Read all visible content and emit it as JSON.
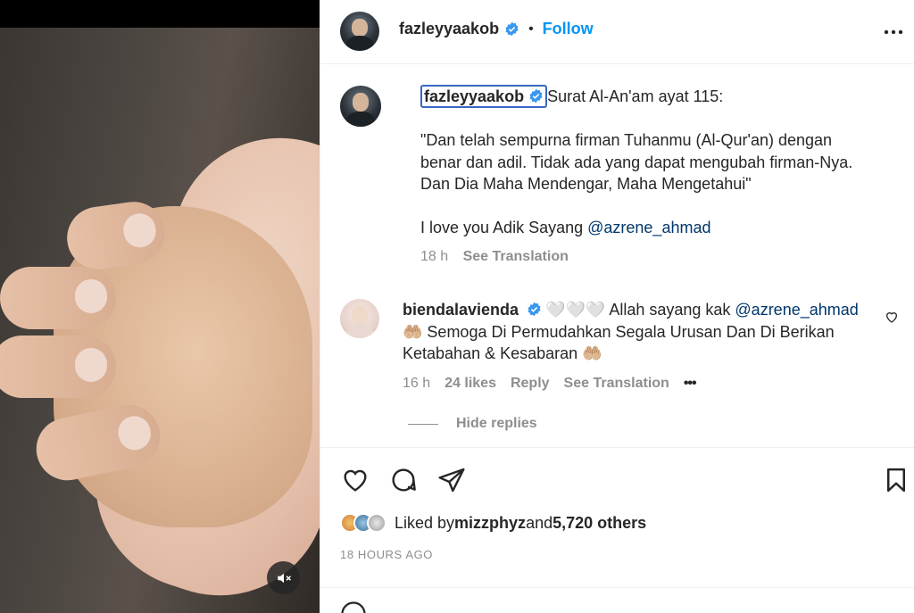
{
  "post": {
    "author": "fazleyyaakob",
    "separator": "•",
    "follow_label": "Follow",
    "more_icon": "more-horizontal-icon",
    "caption": {
      "username": "fazleyyaakob",
      "line1": "Surat Al-An'am ayat 115:",
      "quote_line1": "\"Dan telah sempurna firman Tuhanmu (Al-Qur'an) dengan",
      "quote_line2": "benar dan adil. Tidak ada yang dapat mengubah firman-Nya.",
      "quote_line3": "Dan Dia Maha Mendengar, Maha Mengetahui\"",
      "love_text": "I love you Adik Sayang ",
      "mention": "@azrene_ahmad",
      "time": "18 h",
      "see_translation": "See Translation"
    },
    "comment": {
      "username": "biendalavienda",
      "hearts": "🤍🤍🤍",
      "text_before": " Allah sayang kak ",
      "mention": "@azrene_ahmad",
      "line2": " Semoga Di Permudahkan Segala Urusan Dan Di Berikan",
      "line3": "Ketabahan & Kesabaran ",
      "hands": "🤲🏼",
      "time": "16 h",
      "likes": "24 likes",
      "reply": "Reply",
      "see_translation": "See Translation",
      "more": "•••"
    },
    "hide_replies": "Hide replies",
    "liked_by": {
      "prefix": "Liked by ",
      "user": "mizzphyz",
      "middle": " and ",
      "others": "5,720 others"
    },
    "timestamp": "18 HOURS AGO"
  },
  "icons": {
    "like": "heart-icon",
    "comment": "comment-icon",
    "share": "send-icon",
    "save": "bookmark-icon",
    "mute": "speaker-muted-icon"
  },
  "colors": {
    "link_blue": "#0095f6",
    "mention_blue": "#00376b",
    "verified_blue": "#3897f0",
    "muted_text": "#8e8e8e"
  }
}
